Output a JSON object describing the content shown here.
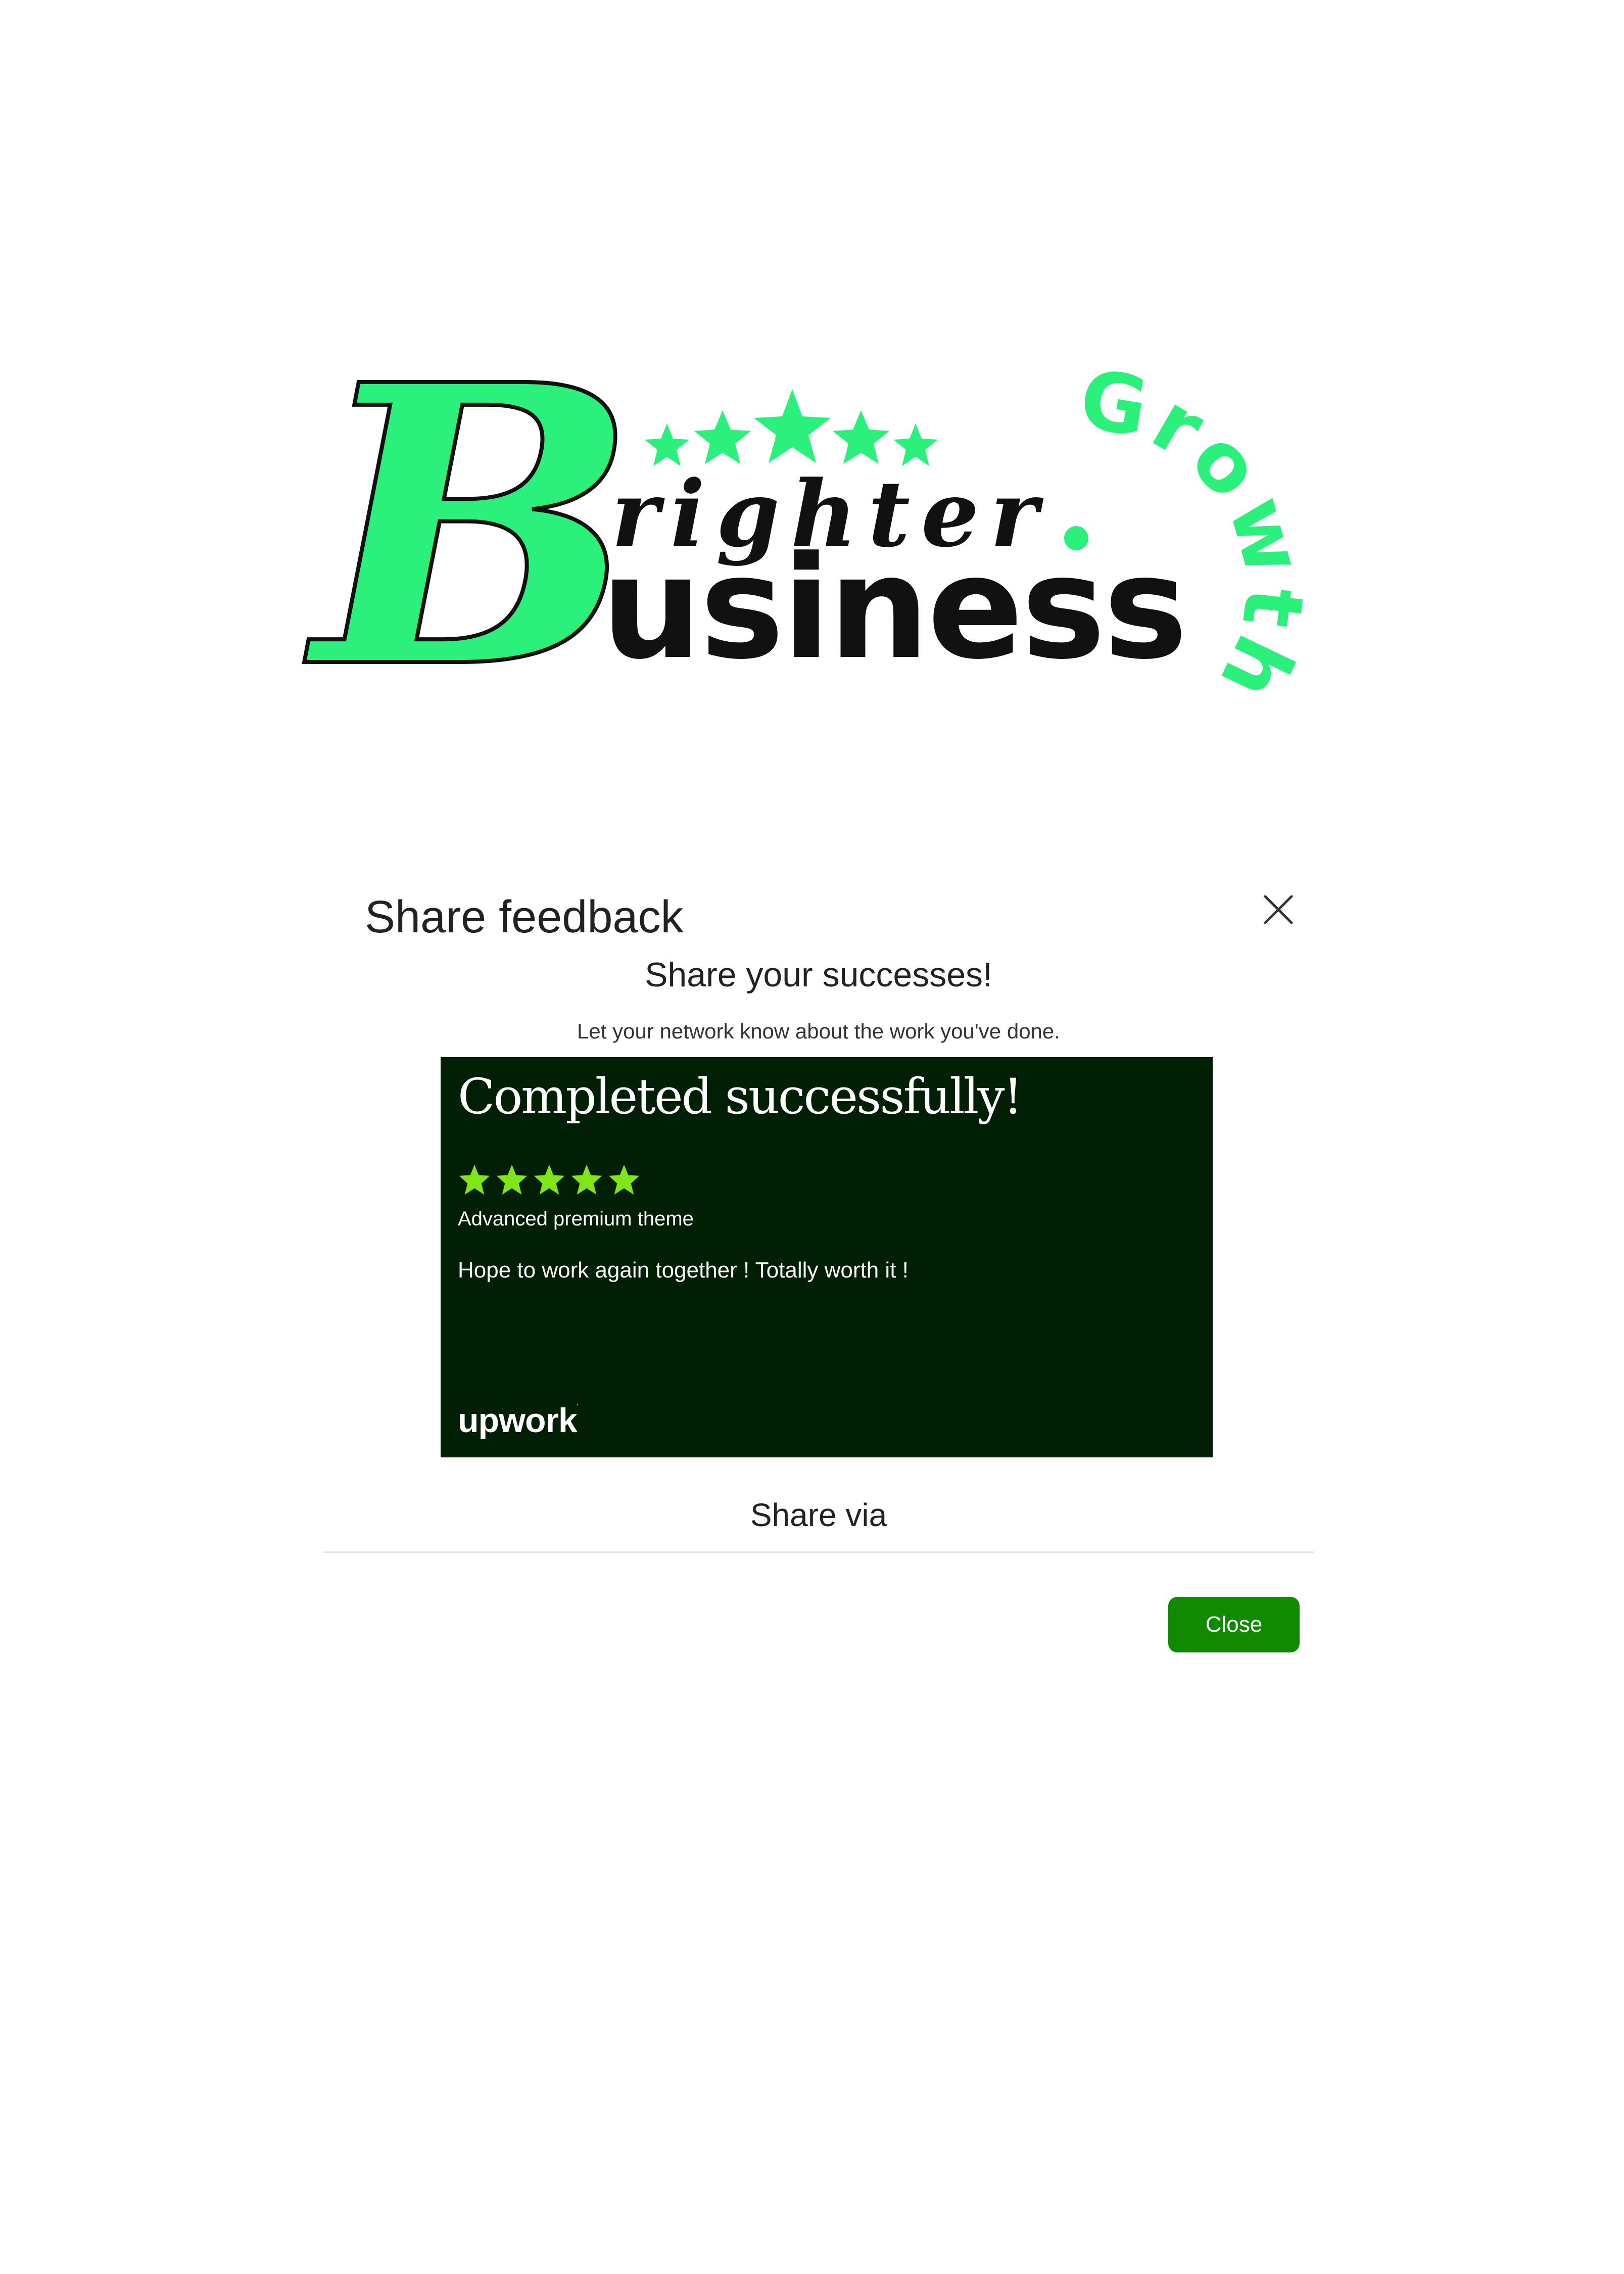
{
  "logo": {
    "b_letter": "B",
    "word_top": "righter",
    "dot": ".",
    "word_bottom": "usiness",
    "tagline": "Growth",
    "star_count": 5,
    "colors": {
      "accent": "#2bf07b",
      "text": "#111111"
    }
  },
  "modal": {
    "title": "Share feedback",
    "close_icon": "close-icon",
    "subtitle": "Share your successes!",
    "description": "Let your network know about the work you've done.",
    "card": {
      "headline": "Completed successfully!",
      "rating": 5,
      "rating_max": 5,
      "project_title": "Advanced premium theme",
      "comment": "Hope to work again together ! Totally worth it !",
      "brand": "upwork",
      "background_color": "#011f04",
      "star_color": "#80e61a"
    },
    "share_via_label": "Share via",
    "close_button_label": "Close",
    "close_button_color": "#108a00"
  }
}
